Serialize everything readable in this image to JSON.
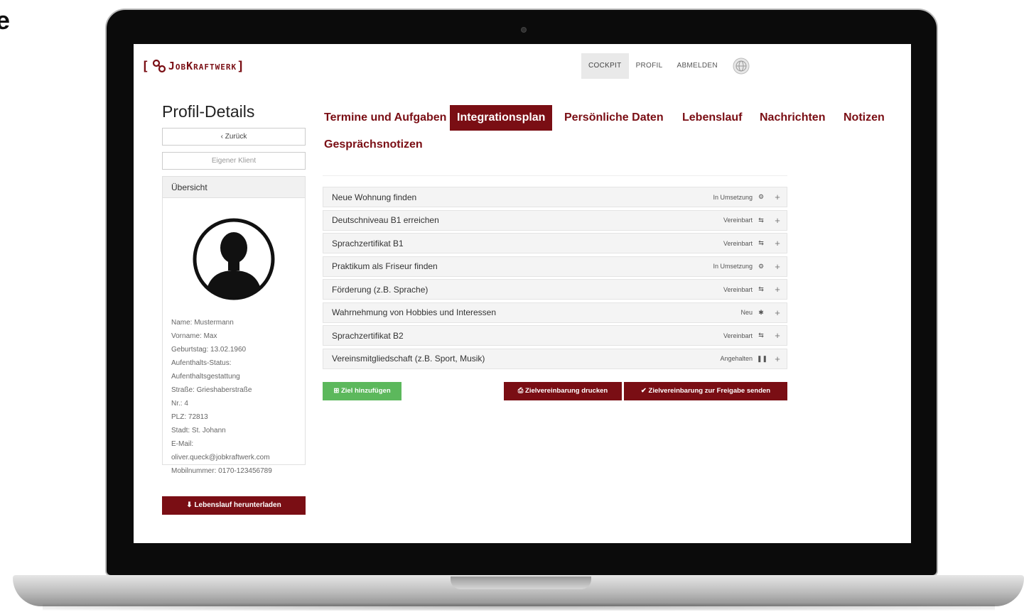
{
  "corner_text": "e",
  "app": {
    "logo_text": "JobKraftwerk",
    "bracket_open": "[",
    "bracket_close": "]",
    "brand_color": "#7a0e14"
  },
  "topnav": {
    "items": [
      "COCKPIT",
      "PROFIL",
      "ABMELDEN"
    ],
    "active": "COCKPIT"
  },
  "page_title": "Profil-Details",
  "sidebar": {
    "back_label": "‹ Zurück",
    "client_label": "Eigener Klient",
    "overview_title": "Übersicht",
    "info": [
      "Name: Mustermann",
      "Vorname: Max",
      "Geburtstag: 13.02.1960",
      "Aufenthalts-Status:",
      "Aufenthaltsgestattung",
      "Straße: Grieshaberstraße",
      "Nr.: 4",
      "PLZ: 72813",
      "Stadt: St. Johann",
      "E-Mail:",
      "oliver.queck@jobkraftwerk.com",
      "Mobilnummer: 0170-123456789"
    ],
    "download_label": "Lebenslauf herunterladen"
  },
  "tabs": [
    "Termine und Aufgaben",
    "Integrationsplan",
    "Persönliche Daten",
    "Lebenslauf",
    "Nachrichten",
    "Notizen",
    "Gesprächsnotizen"
  ],
  "active_tab": "Integrationsplan",
  "goals": [
    {
      "title": "Neue Wohnung finden",
      "status": "In Umsetzung",
      "icon": "gears-icon",
      "glyph": "⚙"
    },
    {
      "title": "Deutschniveau B1 erreichen",
      "status": "Vereinbart",
      "icon": "handshake-icon",
      "glyph": "⇆"
    },
    {
      "title": "Sprachzertifikat B1",
      "status": "Vereinbart",
      "icon": "handshake-icon",
      "glyph": "⇆"
    },
    {
      "title": "Praktikum als Friseur finden",
      "status": "In Umsetzung",
      "icon": "gears-icon",
      "glyph": "⚙"
    },
    {
      "title": "Förderung (z.B. Sprache)",
      "status": "Vereinbart",
      "icon": "handshake-icon",
      "glyph": "⇆"
    },
    {
      "title": "Wahrnehmung von Hobbies und Interessen",
      "status": "Neu",
      "icon": "star-icon",
      "glyph": "✱"
    },
    {
      "title": "Sprachzertifikat B2",
      "status": "Vereinbart",
      "icon": "handshake-icon",
      "glyph": "⇆"
    },
    {
      "title": "Vereinsmitgliedschaft (z.B. Sport, Musik)",
      "status": "Angehalten",
      "icon": "pause-icon",
      "glyph": "❚❚"
    }
  ],
  "actions": {
    "add_goal": "Ziel hinzufügen",
    "print": "Zielvereinbarung drucken",
    "send": "Zielvereinbarung zur Freigabe senden"
  },
  "colors": {
    "primary": "#7a0e14",
    "success": "#5cb85c",
    "row_bg": "#f4f4f4"
  }
}
